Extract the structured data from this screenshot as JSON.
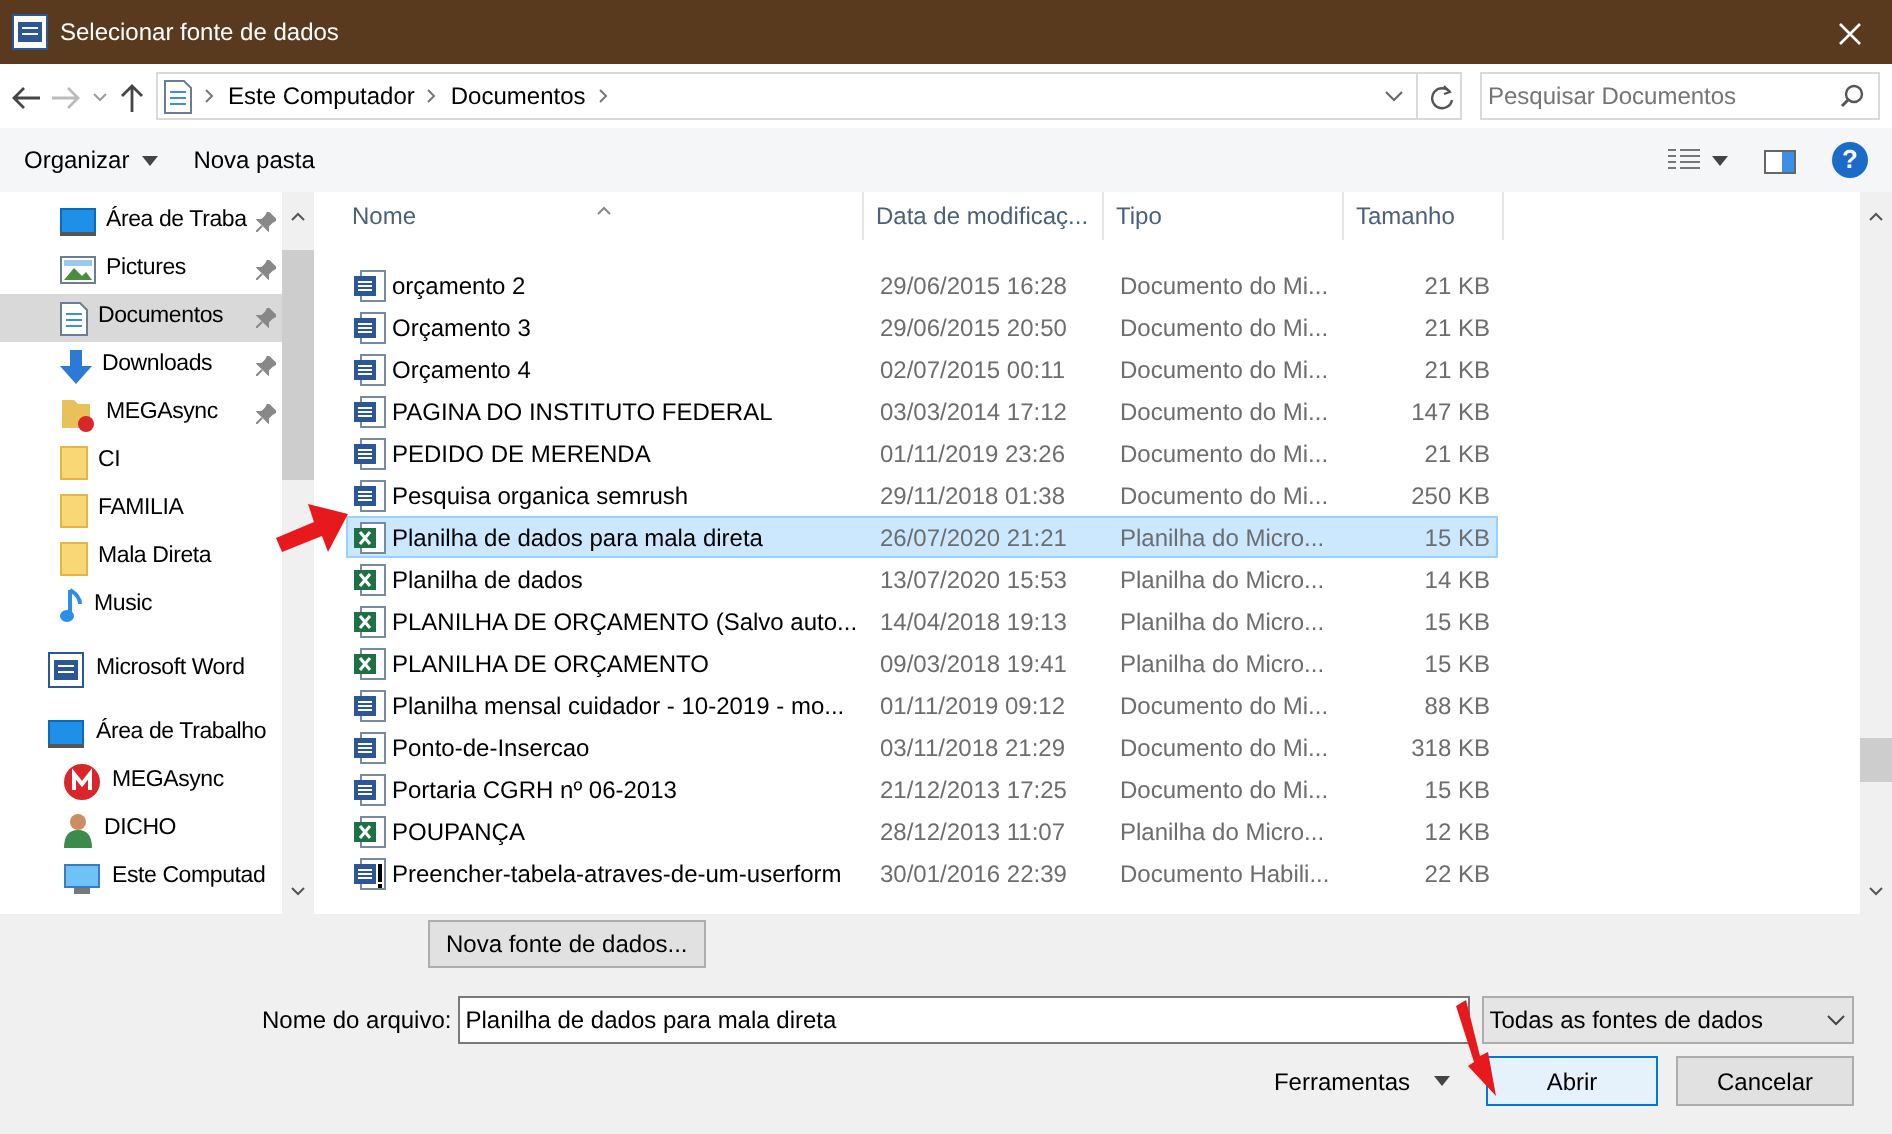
{
  "window": {
    "title": "Selecionar fonte de dados"
  },
  "address": {
    "breadcrumbs": [
      "Este Computador",
      "Documentos"
    ]
  },
  "search": {
    "placeholder": "Pesquisar Documentos"
  },
  "toolbar": {
    "organize": "Organizar",
    "new_folder": "Nova pasta"
  },
  "sidebar": {
    "quick_access": [
      {
        "label": "Área de Traba",
        "kind": "desktop",
        "pinned": true,
        "selected": false
      },
      {
        "label": "Pictures",
        "kind": "pictures",
        "pinned": true,
        "selected": false
      },
      {
        "label": "Documentos",
        "kind": "documents",
        "pinned": true,
        "selected": true
      },
      {
        "label": "Downloads",
        "kind": "downloads",
        "pinned": true,
        "selected": false
      },
      {
        "label": "MEGAsync",
        "kind": "megafolder",
        "pinned": true,
        "selected": false
      },
      {
        "label": "CI",
        "kind": "folder",
        "pinned": false,
        "selected": false
      },
      {
        "label": "FAMILIA",
        "kind": "folder",
        "pinned": false,
        "selected": false
      },
      {
        "label": "Mala Direta",
        "kind": "folder",
        "pinned": false,
        "selected": false
      },
      {
        "label": "Music",
        "kind": "music",
        "pinned": false,
        "selected": false
      }
    ],
    "locations": [
      {
        "label": "Microsoft Word",
        "kind": "word",
        "selected": false
      },
      {
        "label": "Área de Trabalho",
        "kind": "desktop",
        "selected": false,
        "children": [
          {
            "label": "MEGAsync",
            "kind": "mega",
            "selected": false
          },
          {
            "label": "DICHO",
            "kind": "user",
            "selected": false
          },
          {
            "label": "Este Computad",
            "kind": "computer",
            "selected": false
          }
        ]
      }
    ]
  },
  "help": "?",
  "table": {
    "columns": [
      "Nome",
      "Data de modificaç...",
      "Tipo",
      "Tamanho"
    ],
    "rows": [
      {
        "name": "orçamento 2",
        "date": "29/06/2015 16:28",
        "type": "Documento do Mi...",
        "size": "21 KB",
        "kind": "word",
        "selected": false
      },
      {
        "name": "Orçamento 3",
        "date": "29/06/2015 20:50",
        "type": "Documento do Mi...",
        "size": "21 KB",
        "kind": "word",
        "selected": false
      },
      {
        "name": "Orçamento 4",
        "date": "02/07/2015 00:11",
        "type": "Documento do Mi...",
        "size": "21 KB",
        "kind": "word",
        "selected": false
      },
      {
        "name": "PAGINA DO INSTITUTO FEDERAL",
        "date": "03/03/2014 17:12",
        "type": "Documento do Mi...",
        "size": "147 KB",
        "kind": "word",
        "selected": false
      },
      {
        "name": "PEDIDO DE MERENDA",
        "date": "01/11/2019 23:26",
        "type": "Documento do Mi...",
        "size": "21 KB",
        "kind": "word",
        "selected": false
      },
      {
        "name": "Pesquisa organica semrush",
        "date": "29/11/2018 01:38",
        "type": "Documento do Mi...",
        "size": "250 KB",
        "kind": "word",
        "selected": false
      },
      {
        "name": "Planilha de dados para mala direta",
        "date": "26/07/2020 21:21",
        "type": "Planilha do Micro...",
        "size": "15 KB",
        "kind": "excel",
        "selected": true
      },
      {
        "name": "Planilha de dados",
        "date": "13/07/2020 15:53",
        "type": "Planilha do Micro...",
        "size": "14 KB",
        "kind": "excel",
        "selected": false
      },
      {
        "name": "PLANILHA DE ORÇAMENTO (Salvo auto...",
        "date": "14/04/2018 19:13",
        "type": "Planilha do Micro...",
        "size": "15 KB",
        "kind": "excel",
        "selected": false
      },
      {
        "name": "PLANILHA DE ORÇAMENTO",
        "date": "09/03/2018 19:41",
        "type": "Planilha do Micro...",
        "size": "15 KB",
        "kind": "excel",
        "selected": false
      },
      {
        "name": "Planilha mensal cuidador - 10-2019 - mo...",
        "date": "01/11/2019 09:12",
        "type": "Documento do Mi...",
        "size": "88 KB",
        "kind": "word",
        "selected": false
      },
      {
        "name": "Ponto-de-Insercao",
        "date": "03/11/2018 21:29",
        "type": "Documento do Mi...",
        "size": "318 KB",
        "kind": "word",
        "selected": false
      },
      {
        "name": "Portaria CGRH nº 06-2013",
        "date": "21/12/2013 17:25",
        "type": "Documento do Mi...",
        "size": "15 KB",
        "kind": "word",
        "selected": false
      },
      {
        "name": "POUPANÇA",
        "date": "28/12/2013 11:07",
        "type": "Planilha do Micro...",
        "size": "12 KB",
        "kind": "excel",
        "selected": false
      },
      {
        "name": "Preencher-tabela-atraves-de-um-userform",
        "date": "30/01/2016 22:39",
        "type": "Documento Habili...",
        "size": "22 KB",
        "kind": "word-macro",
        "selected": false
      }
    ]
  },
  "new_source_button": "Nova fonte de dados...",
  "filename": {
    "label": "Nome do arquivo:",
    "value": "Planilha de dados para mala direta"
  },
  "filter": {
    "value": "Todas as fontes de dados"
  },
  "tools": "Ferramentas",
  "buttons": {
    "open": "Abrir",
    "cancel": "Cancelar"
  }
}
